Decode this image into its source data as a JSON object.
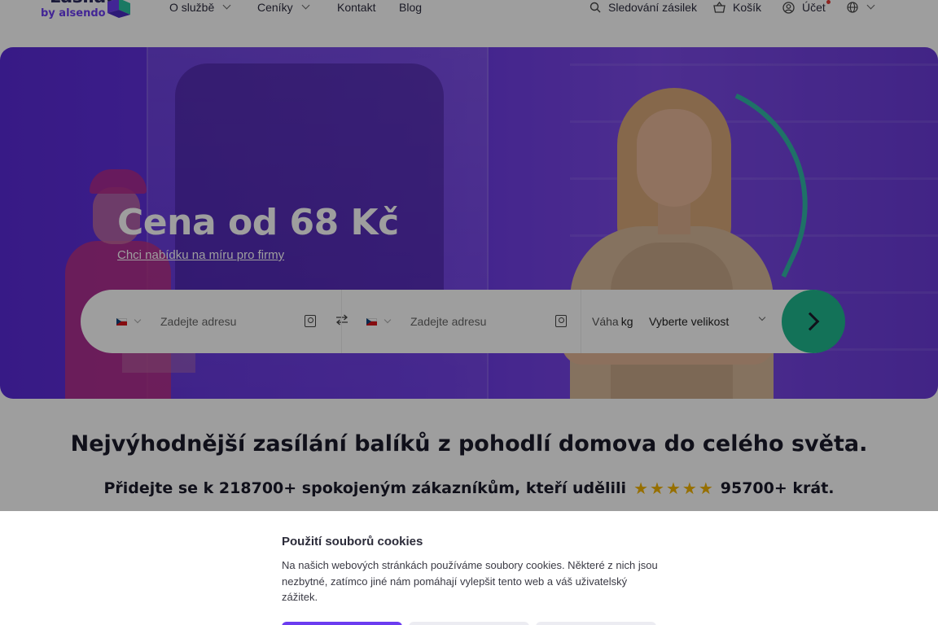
{
  "header": {
    "logo": {
      "word": "zasilat",
      "sub": "by alsendo"
    },
    "nav": [
      {
        "label": "O službě",
        "has_dropdown": true
      },
      {
        "label": "Ceníky",
        "has_dropdown": true
      },
      {
        "label": "Kontakt",
        "has_dropdown": false
      },
      {
        "label": "Blog",
        "has_dropdown": false
      }
    ],
    "tracking_label": "Sledování zásilek",
    "cart_label": "Košík",
    "account_label": "Účet",
    "language_icon": "globe-icon"
  },
  "hero": {
    "title": "Cena od 68 Kč",
    "link": "Chci nabídku na míru pro firmy"
  },
  "search": {
    "from": {
      "country": "CZ",
      "placeholder": "Zadejte adresu"
    },
    "to": {
      "country": "CZ",
      "placeholder": "Zadejte adresu"
    },
    "weight_label": "Váha",
    "weight_unit": "kg",
    "size_select": "Vyberte velikost"
  },
  "main": {
    "headline": "Nejvýhodnější zasílání balíků z pohodlí domova do celého světa.",
    "subline_before": "Přidejte se k 218700+ spokojeným zákazníkům, kteří udělili",
    "stars": 5,
    "subline_after": "95700+ krát."
  },
  "cookie": {
    "title": "Použití souborů cookies",
    "text": "Na našich webových stránkách používáme soubory cookies. Některé z nich jsou nezbytné, zatímco jiné nám pomáhají vylepšit tento web a váš uživatelský zážitek."
  },
  "colors": {
    "brand_purple": "#6b3cf0",
    "accent_green": "#1fb98f",
    "star": "#f3b400"
  }
}
